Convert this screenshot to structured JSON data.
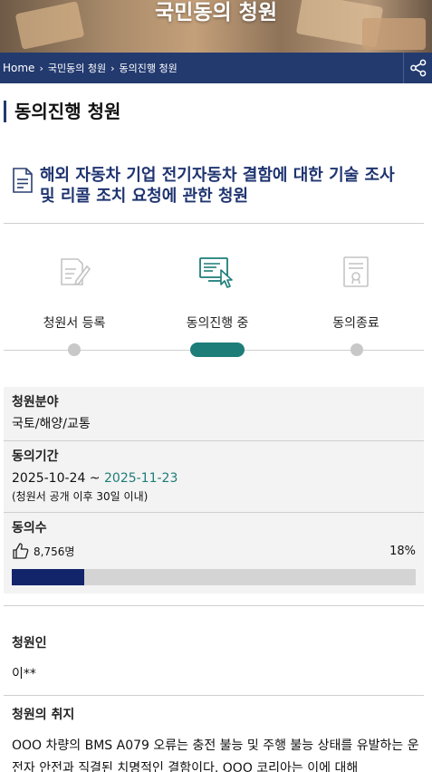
{
  "hero": {
    "title": "국민동의 청원"
  },
  "breadcrumb": {
    "items": [
      "Home",
      "국민동의 청원",
      "동의진행 청원"
    ],
    "separator": "›"
  },
  "share": {
    "icon": "share-icon"
  },
  "section": {
    "title": "동의진행 청원"
  },
  "petition": {
    "title_line1": "해외 자동차 기업 전기자동차 결함에 대한 기술 조사",
    "title_line2": "및 리콜 조치 요청에 관한 청원",
    "icon": "document-icon"
  },
  "steps": [
    {
      "label": "청원서 등록",
      "icon": "document-edit-icon",
      "active": false
    },
    {
      "label": "동의진행 중",
      "icon": "computer-click-icon",
      "active": true
    },
    {
      "label": "동의종료",
      "icon": "certificate-icon",
      "active": false
    }
  ],
  "details": {
    "field_label": "청원분야",
    "field_value": "국토/해양/교통",
    "period_label": "동의기간",
    "period_start": "2025-10-24 ~ ",
    "period_end": "2025-11-23",
    "period_note": "(청원서 공개 이후 30일 이내)",
    "votes_label": "동의수",
    "votes_count": "8,756명",
    "votes_percent": "18%",
    "votes_fraction": 0.18
  },
  "petitioner": {
    "label": "청원인",
    "value": "이**"
  },
  "purpose": {
    "label": "청원의 취지",
    "text": "OOO 차량의 BMS A079 오류는 충전 불능 및 주행 불능 상태를 유발하는 운전자 안전과 직결된 치명적인 결함이다. OOO 코리아는 이에 대해"
  },
  "colors": {
    "navy": "#233a6f",
    "teal": "#1d7d78",
    "progress": "#13256a"
  }
}
